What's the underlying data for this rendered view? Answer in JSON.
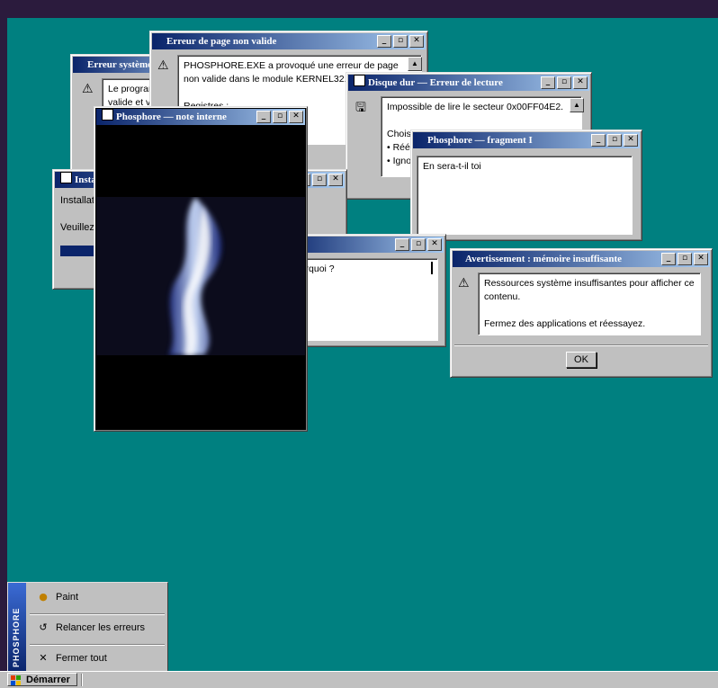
{
  "windows": {
    "erreur_systeme": {
      "title": "Erreur système",
      "message": "Le programme\nvalide et va"
    },
    "page_non_valide": {
      "title": "Erreur de page non valide",
      "message": "PHOSPHORE.EXE a provoqué une erreur de page non valide dans le module KERNEL32.DLL à 0\n\nRegistres :\nc003d7ef"
    },
    "disque_dur": {
      "title": "Disque dur — Erreur de lecture",
      "message": "Impossible de lire le secteur 0x00FF04E2.\n\nChoisi\n• Réé\n• Igno"
    },
    "installation": {
      "title": "Insta",
      "line1": "Installati",
      "line2": "Veuillez p"
    },
    "note_interne": {
      "title": "Phosphore — note interne"
    },
    "fragment": {
      "title": "Phosphore — fragment I",
      "text": "En sera-t-il toi"
    },
    "pourquoi": {
      "text": "pourquoi ?"
    },
    "memoire": {
      "title": "Avertissement : mémoire insuffisante",
      "message": "Ressources système insuffisantes pour afficher ce contenu.\n\nFermez des applications et réessayez.",
      "ok": "OK"
    }
  },
  "startmenu": {
    "brand": "PHOSPHORE",
    "items": [
      {
        "label": "Paint",
        "icon": "palette-icon"
      },
      {
        "label": "Relancer les erreurs",
        "icon": "refresh-icon"
      },
      {
        "label": "Fermer tout",
        "icon": "close-icon"
      }
    ]
  },
  "taskbar": {
    "start": "Démarrer"
  },
  "colors": {
    "desktop": "#008080",
    "titlebar": "#0a246a",
    "frame": "#c0c0c0"
  }
}
